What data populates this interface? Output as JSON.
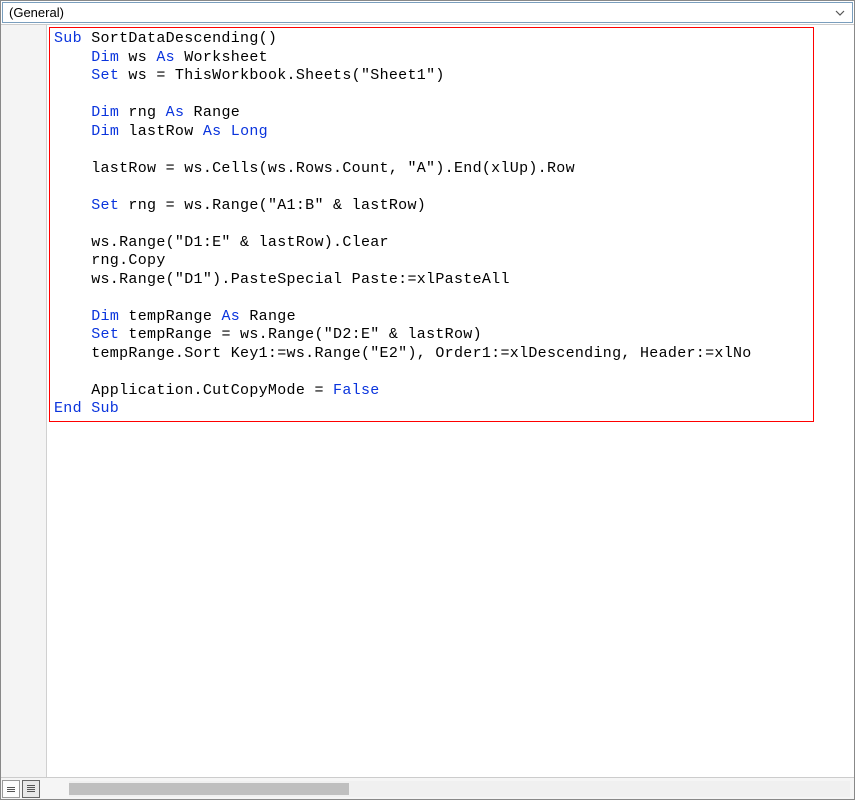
{
  "dropdown": {
    "label": "(General)"
  },
  "code": {
    "lines": [
      [
        [
          "kw",
          "Sub"
        ],
        [
          "txt",
          " SortDataDescending()"
        ]
      ],
      [
        [
          "txt",
          "    "
        ],
        [
          "kw",
          "Dim"
        ],
        [
          "txt",
          " ws "
        ],
        [
          "kw",
          "As"
        ],
        [
          "txt",
          " Worksheet"
        ]
      ],
      [
        [
          "txt",
          "    "
        ],
        [
          "kw",
          "Set"
        ],
        [
          "txt",
          " ws = ThisWorkbook.Sheets(\"Sheet1\")"
        ]
      ],
      [
        [
          "txt",
          ""
        ]
      ],
      [
        [
          "txt",
          "    "
        ],
        [
          "kw",
          "Dim"
        ],
        [
          "txt",
          " rng "
        ],
        [
          "kw",
          "As"
        ],
        [
          "txt",
          " Range"
        ]
      ],
      [
        [
          "txt",
          "    "
        ],
        [
          "kw",
          "Dim"
        ],
        [
          "txt",
          " lastRow "
        ],
        [
          "kw",
          "As"
        ],
        [
          "txt",
          " "
        ],
        [
          "kw",
          "Long"
        ]
      ],
      [
        [
          "txt",
          ""
        ]
      ],
      [
        [
          "txt",
          "    lastRow = ws.Cells(ws.Rows.Count, \"A\").End(xlUp).Row"
        ]
      ],
      [
        [
          "txt",
          ""
        ]
      ],
      [
        [
          "txt",
          "    "
        ],
        [
          "kw",
          "Set"
        ],
        [
          "txt",
          " rng = ws.Range(\"A1:B\" & lastRow)"
        ]
      ],
      [
        [
          "txt",
          ""
        ]
      ],
      [
        [
          "txt",
          "    ws.Range(\"D1:E\" & lastRow).Clear"
        ]
      ],
      [
        [
          "txt",
          "    rng.Copy"
        ]
      ],
      [
        [
          "txt",
          "    ws.Range(\"D1\").PasteSpecial Paste:=xlPasteAll"
        ]
      ],
      [
        [
          "txt",
          ""
        ]
      ],
      [
        [
          "txt",
          "    "
        ],
        [
          "kw",
          "Dim"
        ],
        [
          "txt",
          " tempRange "
        ],
        [
          "kw",
          "As"
        ],
        [
          "txt",
          " Range"
        ]
      ],
      [
        [
          "txt",
          "    "
        ],
        [
          "kw",
          "Set"
        ],
        [
          "txt",
          " tempRange = ws.Range(\"D2:E\" & lastRow)"
        ]
      ],
      [
        [
          "txt",
          "    tempRange.Sort Key1:=ws.Range(\"E2\"), Order1:=xlDescending, Header:=xlNo"
        ]
      ],
      [
        [
          "txt",
          ""
        ]
      ],
      [
        [
          "txt",
          "    Application.CutCopyMode = "
        ],
        [
          "kw",
          "False"
        ]
      ],
      [
        [
          "kw",
          "End Sub"
        ]
      ]
    ]
  }
}
